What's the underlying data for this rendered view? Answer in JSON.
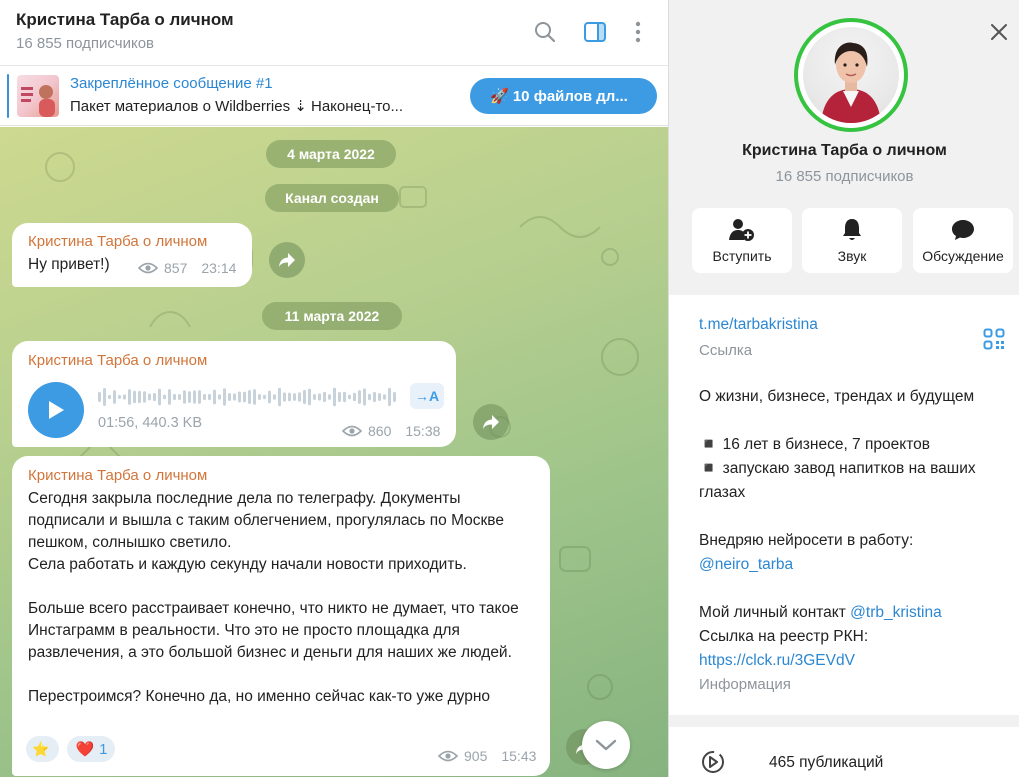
{
  "header": {
    "title": "Кристина Тарба о личном",
    "subscribers": "16 855 подписчиков"
  },
  "pinned": {
    "title": "Закреплённое сообщение #1",
    "text": "Пакет материалов о Wildberries ⇣   Наконец-то...",
    "button_label": "🚀 10 файлов дл..."
  },
  "feed": {
    "dates": [
      "4 марта 2022",
      "11 марта 2022"
    ],
    "service": "Канал создан",
    "messages": [
      {
        "author": "Кристина Тарба о личном",
        "text": "Ну привет!)",
        "views": "857",
        "time": "23:14"
      },
      {
        "author": "Кристина Тарба о личном",
        "voice_info": "01:56, 440.3 KB",
        "transcribe_label": "→A",
        "views": "860",
        "time": "15:38"
      },
      {
        "author": "Кристина Тарба о личном",
        "text": "Сегодня закрыла последние дела по телеграфу. Документы подписали и вышла с таким облегчением, прогулялась по Москве пешком, солнышко светило.\nСела работать и каждую секунду начали новости приходить.\n\nБольше всего расстраивает конечно, что никто не думает, что такое Инстаграмм в реальности. Что это не просто площадка для развлечения, а это большой бизнес и деньги для наших же людей.\n\nПерестроимся? Конечно да, но именно сейчас как-то уже дурно",
        "reactions": [
          {
            "emoji": "⭐",
            "count": ""
          },
          {
            "emoji": "❤️",
            "count": "1"
          }
        ],
        "views": "905",
        "time": "15:43"
      }
    ]
  },
  "panel": {
    "name": "Кристина Тарба о личном",
    "subscribers": "16 855 подписчиков",
    "actions": [
      "Вступить",
      "Звук",
      "Обсуждение"
    ],
    "link": "t.me/tarbakristina",
    "link_caption": "Ссылка",
    "desc_line1": "О жизни, бизнесе, трендах и будущем",
    "bullet1": "◾️ 16 лет в бизнесе, 7 проектов",
    "bullet2": "◾️ запускаю завод напитков на ваших глазах",
    "ai_text": "Внедряю нейросети в работу:",
    "ai_handle": "@neiro_tarba",
    "contact_text": "Мой личный контакт ",
    "contact_handle": "@trb_kristina",
    "rkn_text": "Ссылка на реестр РКН:",
    "rkn_link": "https://clck.ru/3GEVdV",
    "info_caption": "Информация",
    "publications": "465 публикаций"
  },
  "colors": {
    "accent": "#3d9be3",
    "link": "#2b87d2",
    "author": "#d2753a",
    "avatar_ring": "#36c340"
  }
}
